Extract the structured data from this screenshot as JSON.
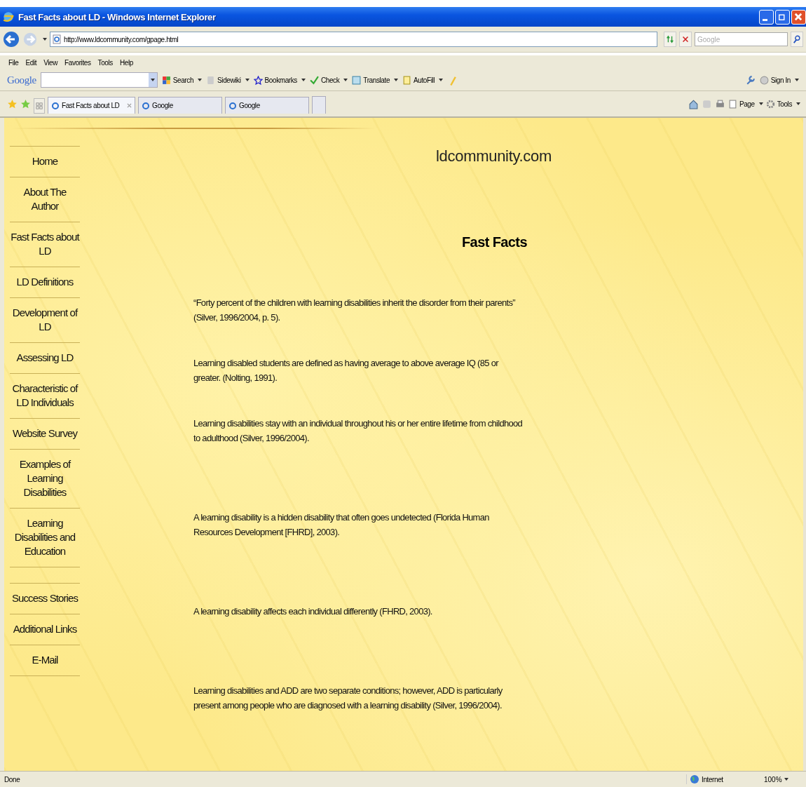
{
  "window": {
    "title": "Fast Facts about LD - Windows Internet Explorer"
  },
  "address_bar": {
    "url": "http://www.ldcommunity.com/gpage.html"
  },
  "search_box": {
    "placeholder": "Google"
  },
  "menu": [
    "File",
    "Edit",
    "View",
    "Favorites",
    "Tools",
    "Help"
  ],
  "google_toolbar": {
    "logo": "Google",
    "buttons": [
      {
        "label": "Search",
        "kind": "search"
      },
      {
        "label": "Sidewiki",
        "kind": "sidewiki"
      },
      {
        "label": "Bookmarks",
        "kind": "bookmarks"
      },
      {
        "label": "Check",
        "kind": "check"
      },
      {
        "label": "Translate",
        "kind": "translate"
      },
      {
        "label": "AutoFill",
        "kind": "autofill"
      }
    ],
    "sign_in": "Sign In"
  },
  "tabs": [
    {
      "label": "Fast Facts about LD",
      "selected": true
    },
    {
      "label": "Google",
      "selected": false
    },
    {
      "label": "Google",
      "selected": false
    }
  ],
  "command_bar": [
    "Page",
    "Tools"
  ],
  "page": {
    "site_title": "ldcommunity.com",
    "heading": "Fast Facts",
    "nav": [
      {
        "label": "Home",
        "kind": "link"
      },
      {
        "label": "About The Author",
        "kind": "link"
      },
      {
        "label": "Fast Facts about LD",
        "kind": "link"
      },
      {
        "label": "LD Definitions",
        "kind": "link"
      },
      {
        "label": "Development of LD",
        "kind": "link"
      },
      {
        "label": "Assessing LD",
        "kind": "link"
      },
      {
        "label": "Characteristic of LD Individuals",
        "kind": "link"
      },
      {
        "label": "Website Survey",
        "kind": "link"
      },
      {
        "label": "Examples of Learning Disabilities",
        "kind": "link"
      },
      {
        "label": "Learning Disabilities and Education",
        "kind": "link"
      },
      {
        "kind": "blank"
      },
      {
        "label": "Success Stories",
        "kind": "link"
      },
      {
        "label": "Additional Links",
        "kind": "link"
      },
      {
        "label": "E-Mail",
        "kind": "link"
      }
    ],
    "facts": [
      "“Forty percent of the children with learning disabilities inherit the disorder from their parents” (Silver, 1996/2004, p. 5).",
      "Learning disabled students are defined as having average to above average IQ (85 or greater. (Nolting, 1991).",
      "Learning disabilities stay with an individual throughout his or her entire lifetime from childhood to adulthood (Silver, 1996/2004).",
      "A learning disability is a hidden disability that often goes undetected (Florida Human Resources Development [FHRD], 2003).",
      "A learning disability affects each individual differently (FHRD, 2003).",
      "Learning disabilities and ADD are two separate conditions; however, ADD is particularly present among people who are diagnosed with a learning disability (Silver, 1996/2004)."
    ]
  },
  "status_bar": {
    "text": "Done",
    "zone": "Internet",
    "zoom": "100%"
  }
}
